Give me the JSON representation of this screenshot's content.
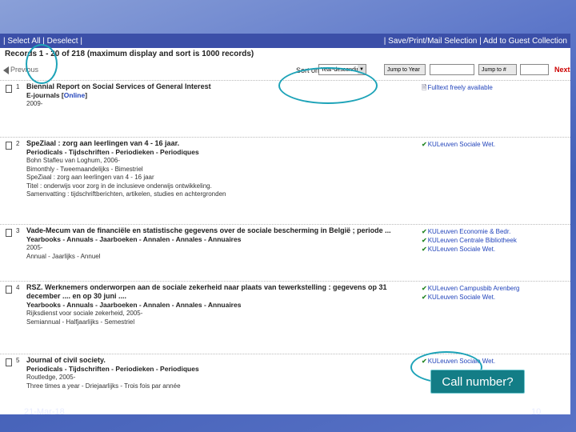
{
  "toolbar": {
    "left": "| Select All | Deselect |",
    "right": "| Save/Print/Mail Selection | Add to Guest Collection"
  },
  "records_info": "Records 1 - 20 of 218 (maximum display and sort is 1000 records)",
  "nav": {
    "previous": "Previous",
    "sort_label": "Sort on",
    "sort_value": "Year-descending",
    "jump_year": "Jump to Year",
    "jump_to": "Jump to #",
    "next": "Next"
  },
  "records": [
    {
      "num": "1",
      "title": "Biennial Report on Social Services of General Interest",
      "type_main": "E-journals",
      "type_link": "Online",
      "lines": [
        "2009-"
      ],
      "holdings": [
        {
          "icon": "document-icon",
          "text": "Fulltext freely available"
        }
      ]
    },
    {
      "num": "2",
      "title": "SpeZiaal : zorg aan leerlingen van 4 - 16 jaar.",
      "type_main": "Periodicals - Tijdschriften - Periodieken - Periodiques",
      "type_link": "",
      "lines": [
        "Bohn Stafleu van Loghum, 2006-",
        "Bimonthly - Tweemaandelijks - Bimestriel",
        "SpeZiaal : zorg aan leerlingen van 4 - 16 jaar",
        "Titel : onderwijs voor zorg in de inclusieve onderwijs ontwikkeling.",
        "Samenvatting : tijdschriftberichten, artikelen, studies en achtergronden"
      ],
      "holdings": [
        {
          "icon": "check-icon",
          "text": "KULeuven Sociale Wet."
        }
      ]
    },
    {
      "num": "3",
      "title": "Vade-Mecum van de financiële en statistische gegevens over de sociale bescherming in België ; periode ...",
      "type_main": "Yearbooks - Annuals - Jaarboeken - Annalen - Annales - Annuaires",
      "type_link": "",
      "lines": [
        "2005-",
        "Annual - Jaarlijks - Annuel"
      ],
      "holdings": [
        {
          "icon": "check-icon",
          "text": "KULeuven Economie & Bedr."
        },
        {
          "icon": "check-icon",
          "text": "KULeuven Centrale Bibliotheek"
        },
        {
          "icon": "check-icon",
          "text": "KULeuven Sociale Wet."
        }
      ]
    },
    {
      "num": "4",
      "title": "RSZ. Werknemers onderworpen aan de sociale zekerheid naar plaats van tewerkstelling : gegevens op 31 december .... en op 30 juni ....",
      "type_main": "Yearbooks - Annuals - Jaarboeken - Annalen - Annales - Annuaires",
      "type_link": "",
      "lines": [
        "Rijksdienst voor sociale zekerheid, 2005-",
        "Semiannual - Halfjaarlijks - Semestriel"
      ],
      "holdings": [
        {
          "icon": "check-icon",
          "text": "KULeuven Campusbib Arenberg"
        },
        {
          "icon": "check-icon",
          "text": "KULeuven Sociale Wet."
        }
      ]
    },
    {
      "num": "5",
      "title": "Journal of civil society.",
      "type_main": "Periodicals - Tijdschriften - Periodieken - Periodiques",
      "type_link": "",
      "lines": [
        "Routledge, 2005-",
        "Three times a year - Driejaarlijks - Trois fois par année"
      ],
      "holdings": [
        {
          "icon": "check-icon",
          "text": "KULeuven Sociale Wet."
        }
      ]
    }
  ],
  "annotation": {
    "callout": "Call number?",
    "color": "#1da3b8"
  },
  "footer": {
    "left": "21-Mar-18",
    "right": "10"
  }
}
